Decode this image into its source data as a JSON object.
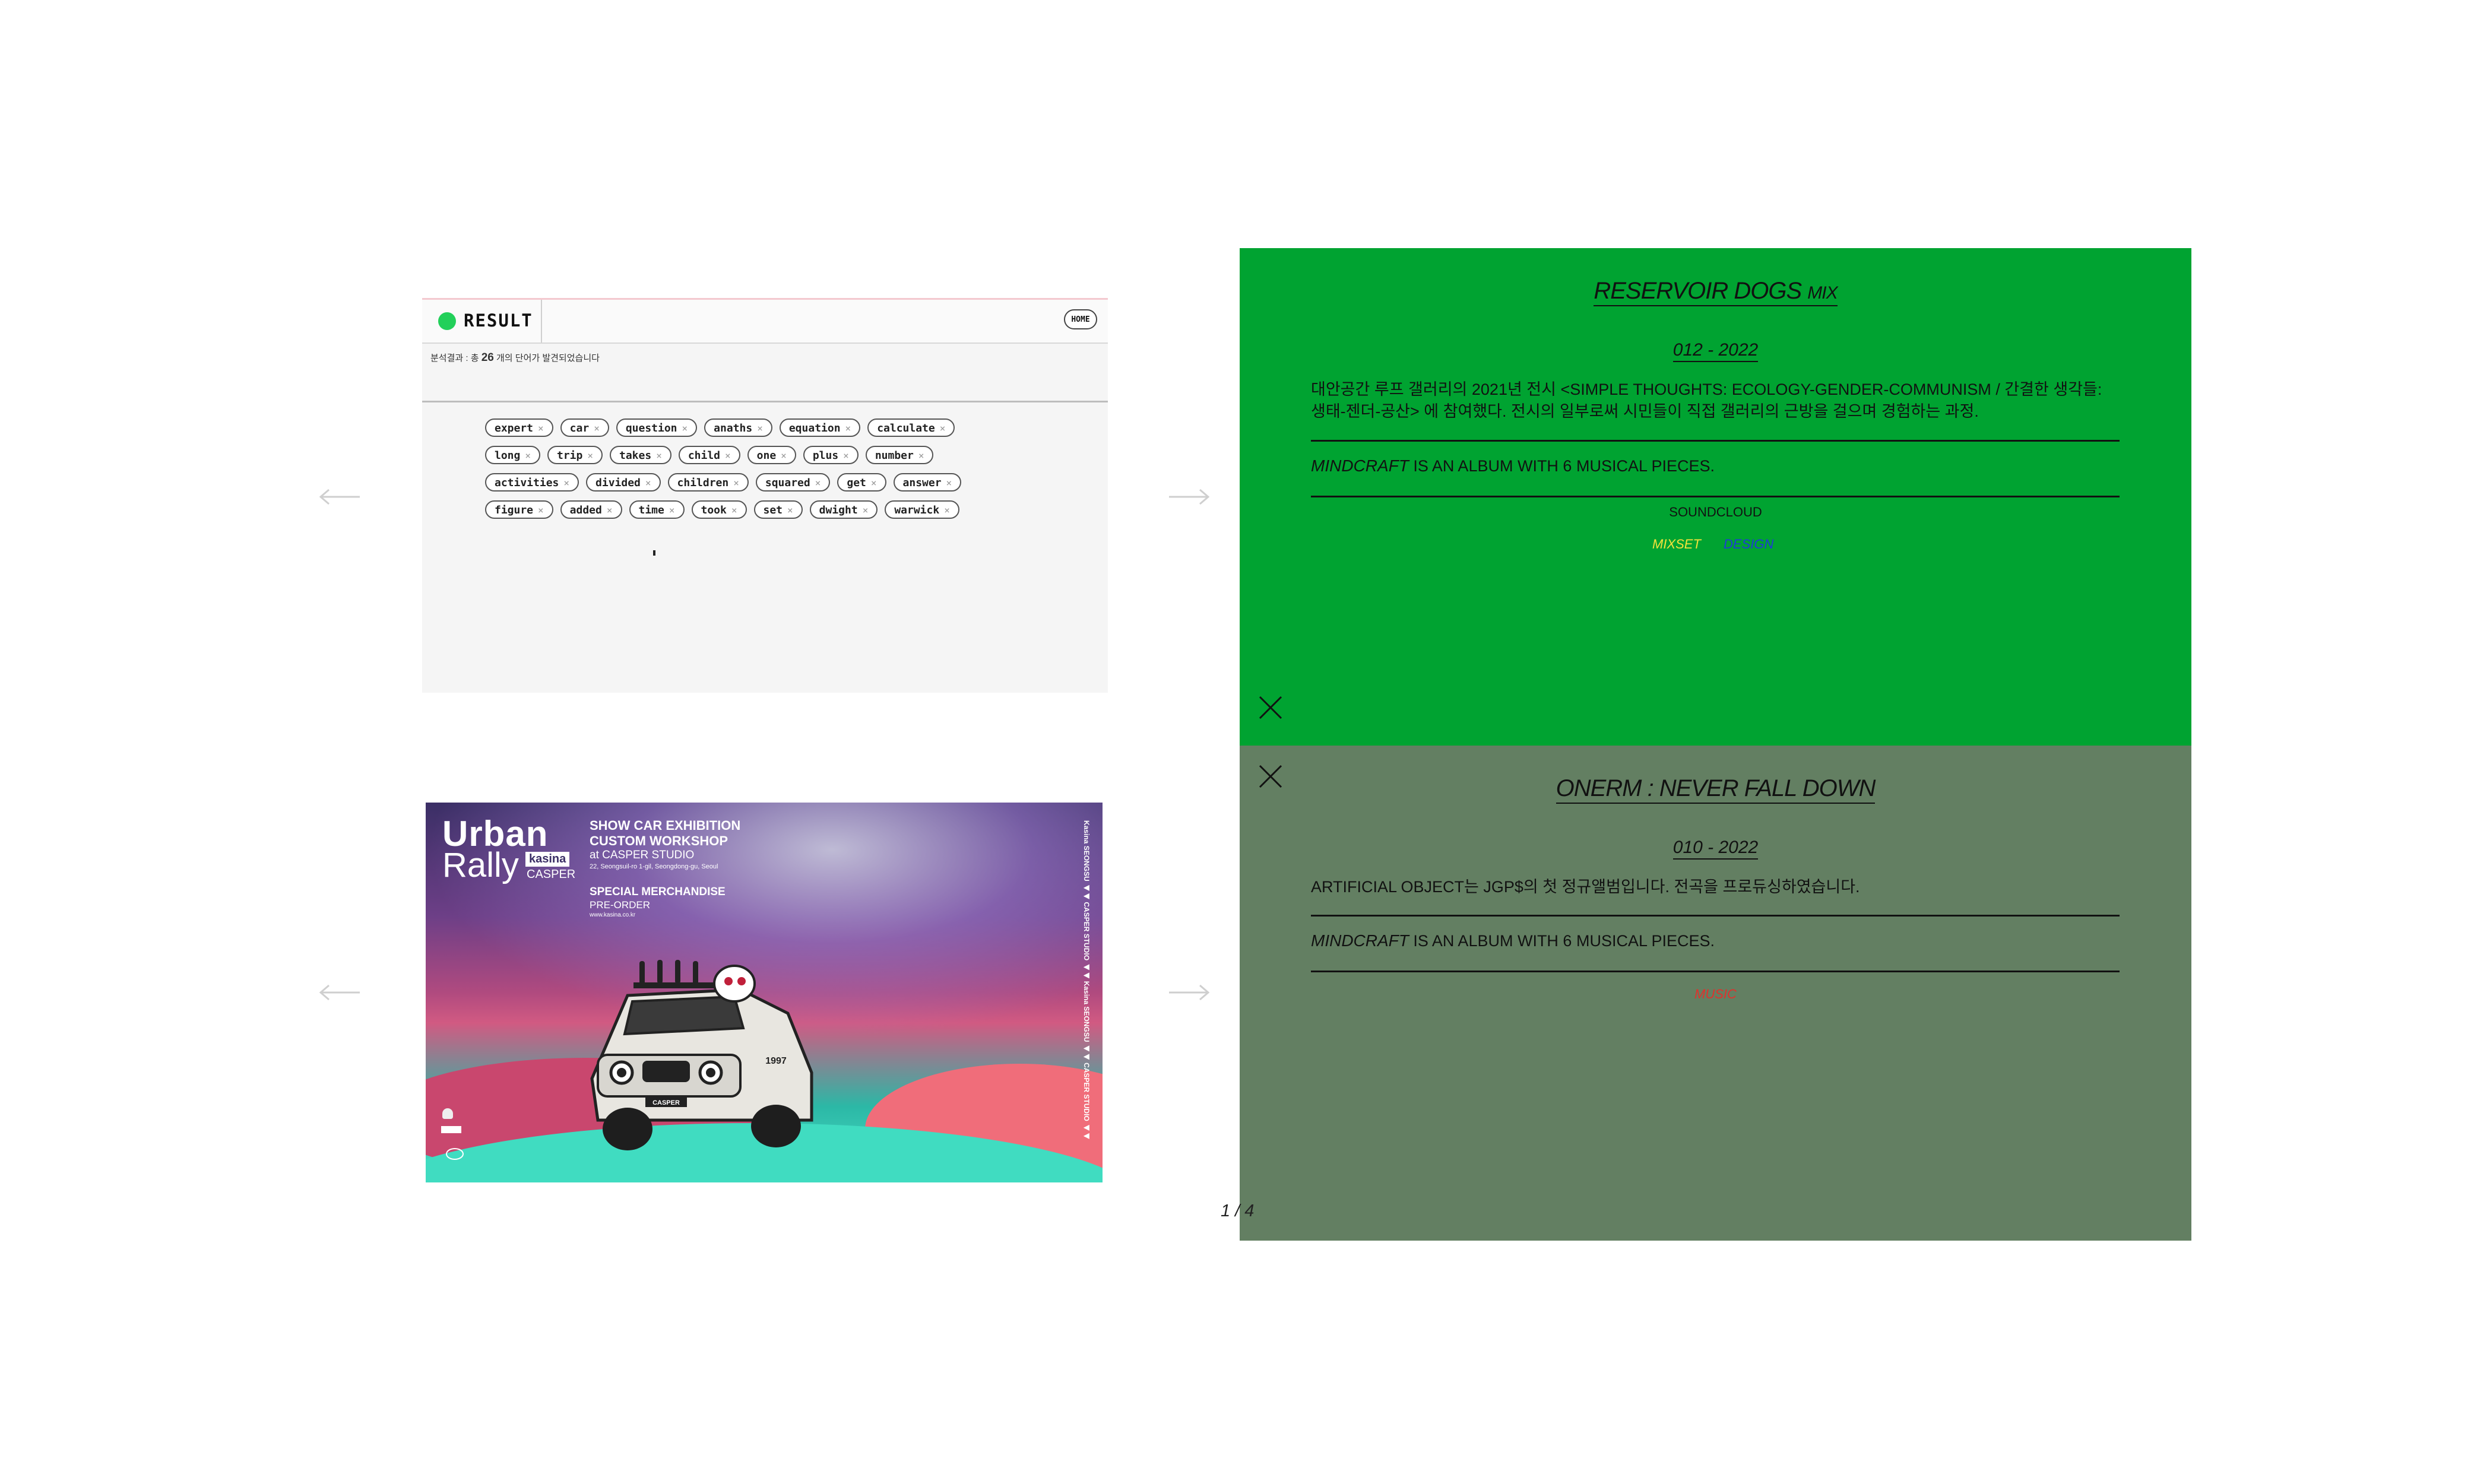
{
  "result_panel": {
    "title": "RESULT",
    "home_label": "HOME",
    "analysis_prefix": "분석결과 : 총",
    "analysis_count": "26",
    "analysis_suffix": "개의 단어가 발견되었습니다",
    "tags": [
      "expert",
      "car",
      "question",
      "anaths",
      "equation",
      "calculate",
      "long",
      "trip",
      "takes",
      "child",
      "one",
      "plus",
      "number",
      "activities",
      "divided",
      "children",
      "squared",
      "get",
      "answer",
      "figure",
      "added",
      "time",
      "took",
      "set",
      "dwight",
      "warwick"
    ],
    "tag_close_glyph": "×"
  },
  "poster": {
    "title_line1": "Urban",
    "title_line2": "Rally",
    "badge": "kasina",
    "brand": "CASPER",
    "heading1": "SHOW CAR EXHIBITION",
    "heading2": "CUSTOM WORKSHOP",
    "heading3": "at CASPER STUDIO",
    "address": "22, Seongsuil-ro 1-gil, Seongdong-gu, Seoul",
    "merch": "SPECIAL MERCHANDISE",
    "preorder": "PRE-ORDER",
    "url": "www.kasina.co.kr",
    "vertical_text": "Kasina SEONGSU ◀◀ CASPER STUDIO ◀◀ Kasina SEONGSU ◀◀ CASPER STUDIO ◀◀",
    "car_label": "CASPER",
    "car_number": "1997"
  },
  "panel_green": {
    "title": "RESERVOIR DOGS",
    "title_suffix": "MIX",
    "date": "012 - 2022",
    "description": "대안공간 루프 갤러리의 2021년 전시 <SIMPLE THOUGHTS: ECOLOGY-GENDER-COMMUNISM / 간결한 생각들: 생태-젠더-공산> 에 참여했다. 전시의 일부로써 시민들이 직접 갤러리의 근방을 걸으며 경험하는 과정.",
    "mind_name": "MINDCRAFT",
    "mind_text": "IS AN ALBUM WITH 6 MUSICAL PIECES.",
    "link_soundcloud": "SOUNDCLOUD",
    "link_mixset": "MIXSET",
    "link_design": "DESIGN",
    "color_soundcloud": "#111111",
    "color_mixset": "#f3e33a",
    "color_design": "#1f3bd6"
  },
  "panel_grey": {
    "title": "ONERM : NEVER FALL DOWN",
    "date": "010 - 2022",
    "description": "ARTIFICIAL OBJECT는 JGP$의 첫 정규앨범입니다. 전곡을 프로듀싱하였습니다.",
    "mind_name": "MINDCRAFT",
    "mind_text": "IS AN ALBUM WITH 6 MUSICAL PIECES.",
    "link_music": "MUSIC",
    "color_music": "#e0312c"
  },
  "pager": "1 / 4",
  "icons": [
    "arrow-left-icon",
    "arrow-right-icon",
    "close-icon"
  ]
}
